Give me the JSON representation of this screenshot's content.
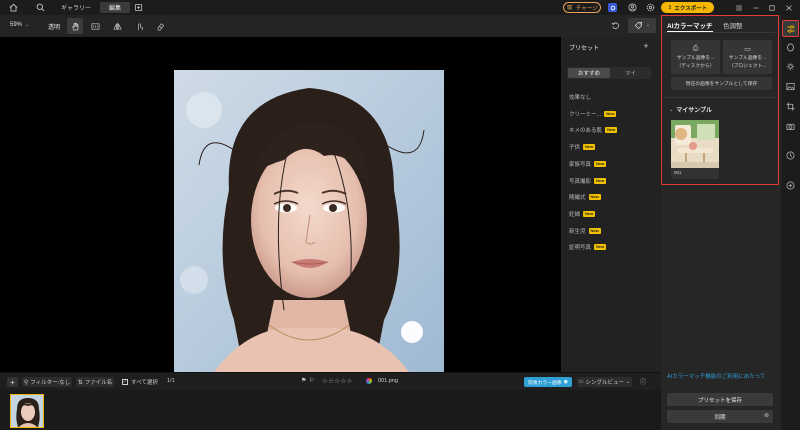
{
  "top_bar": {
    "tab_gallery": "ギャラリー",
    "tab_edit": "編集",
    "charge_label": "チャージ",
    "export_label": "エクスポート"
  },
  "toolbar": {
    "zoom": "59%",
    "transparency_label": "透明"
  },
  "presets": {
    "title": "プリセット",
    "tab_recommended": "おすすめ",
    "tab_mine": "マイ",
    "new_badge": "New",
    "items": [
      {
        "label": "効果なし",
        "new": false
      },
      {
        "label": "クリーミー...",
        "new": true
      },
      {
        "label": "キメのある肌",
        "new": true
      },
      {
        "label": "子供",
        "new": true
      },
      {
        "label": "家族写真",
        "new": true
      },
      {
        "label": "写真撮影",
        "new": true
      },
      {
        "label": "随撮式",
        "new": true
      },
      {
        "label": "妊婦",
        "new": true
      },
      {
        "label": "新生児",
        "new": true
      },
      {
        "label": "証明写真",
        "new": true
      }
    ]
  },
  "right_panel": {
    "tab_ai_color_match": "AIカラーマッチ",
    "tab_color_adjust": "色調整",
    "sample_disk_line1": "サンプル画像を...",
    "sample_disk_line2": "（ディスクから）",
    "sample_project_line1": "サンプル画像を...",
    "sample_project_line2": "（プロジェクト...",
    "save_current_as_sample": "現在の画像をサンプルとして保存",
    "my_samples_title": "マイサンプル",
    "sample_caption": "001",
    "usage_notice_link": "AIカラーマッチ機能のご利用にあたって",
    "save_preset_button": "プリセットを保存",
    "sync_button": "同期"
  },
  "bottom_bar": {
    "filter_label": "フィルター:なし",
    "filename_label": "ファイル名",
    "select_all_label": "すべて選択",
    "page_counter": "1/1",
    "rating_stars": "☆☆☆☆☆",
    "filename": "001.png",
    "before_after_label": "前後カラー画像",
    "single_view_label": "シングルビュー"
  },
  "colors": {
    "accent_blue": "#2fa0d6",
    "charge_orange": "#e8a25c",
    "export_yellow": "#f5b700",
    "new_badge": "#f2c200",
    "highlight_red": "#e23b3b"
  }
}
